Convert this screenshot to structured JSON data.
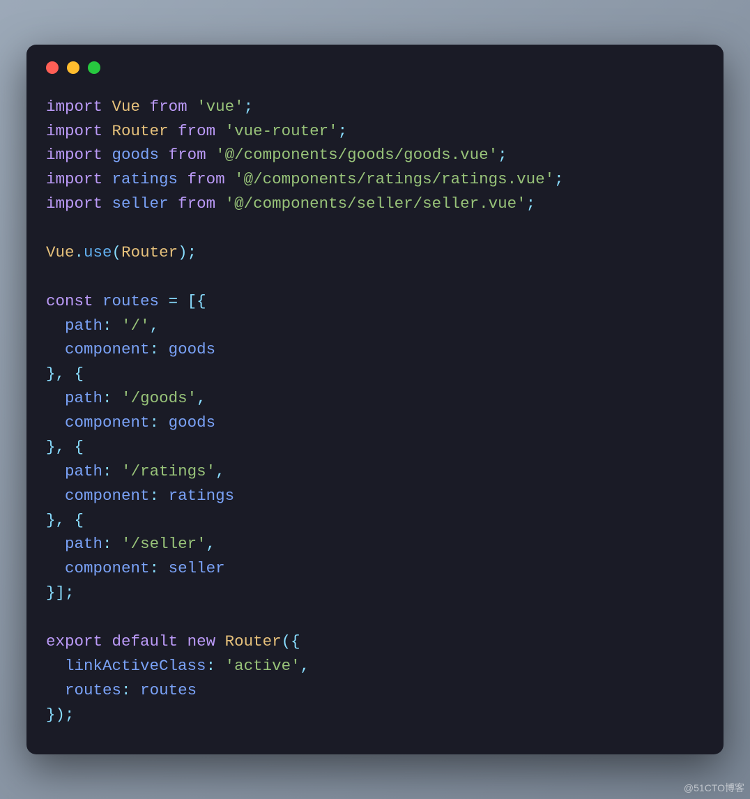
{
  "watermark": "@51CTO博客",
  "titlebar": {
    "dots": [
      "red",
      "yellow",
      "green"
    ]
  },
  "code": {
    "lines": [
      [
        {
          "c": "kw",
          "t": "import"
        },
        {
          "c": "pl",
          "t": " "
        },
        {
          "c": "cls",
          "t": "Vue"
        },
        {
          "c": "pl",
          "t": " "
        },
        {
          "c": "kw",
          "t": "from"
        },
        {
          "c": "pl",
          "t": " "
        },
        {
          "c": "str",
          "t": "'vue'"
        },
        {
          "c": "pun",
          "t": ";"
        }
      ],
      [
        {
          "c": "kw",
          "t": "import"
        },
        {
          "c": "pl",
          "t": " "
        },
        {
          "c": "cls",
          "t": "Router"
        },
        {
          "c": "pl",
          "t": " "
        },
        {
          "c": "kw",
          "t": "from"
        },
        {
          "c": "pl",
          "t": " "
        },
        {
          "c": "str",
          "t": "'vue-router'"
        },
        {
          "c": "pun",
          "t": ";"
        }
      ],
      [
        {
          "c": "kw",
          "t": "import"
        },
        {
          "c": "pl",
          "t": " "
        },
        {
          "c": "id",
          "t": "goods"
        },
        {
          "c": "pl",
          "t": " "
        },
        {
          "c": "kw",
          "t": "from"
        },
        {
          "c": "pl",
          "t": " "
        },
        {
          "c": "str",
          "t": "'@/components/goods/goods.vue'"
        },
        {
          "c": "pun",
          "t": ";"
        }
      ],
      [
        {
          "c": "kw",
          "t": "import"
        },
        {
          "c": "pl",
          "t": " "
        },
        {
          "c": "id",
          "t": "ratings"
        },
        {
          "c": "pl",
          "t": " "
        },
        {
          "c": "kw",
          "t": "from"
        },
        {
          "c": "pl",
          "t": " "
        },
        {
          "c": "str",
          "t": "'@/components/ratings/ratings.vue'"
        },
        {
          "c": "pun",
          "t": ";"
        }
      ],
      [
        {
          "c": "kw",
          "t": "import"
        },
        {
          "c": "pl",
          "t": " "
        },
        {
          "c": "id",
          "t": "seller"
        },
        {
          "c": "pl",
          "t": " "
        },
        {
          "c": "kw",
          "t": "from"
        },
        {
          "c": "pl",
          "t": " "
        },
        {
          "c": "str",
          "t": "'@/components/seller/seller.vue'"
        },
        {
          "c": "pun",
          "t": ";"
        }
      ],
      [],
      [
        {
          "c": "cls",
          "t": "Vue"
        },
        {
          "c": "pun",
          "t": "."
        },
        {
          "c": "fn",
          "t": "use"
        },
        {
          "c": "pun",
          "t": "("
        },
        {
          "c": "cls",
          "t": "Router"
        },
        {
          "c": "pun",
          "t": ");"
        }
      ],
      [],
      [
        {
          "c": "kw",
          "t": "const"
        },
        {
          "c": "pl",
          "t": " "
        },
        {
          "c": "id",
          "t": "routes"
        },
        {
          "c": "pl",
          "t": " "
        },
        {
          "c": "op",
          "t": "="
        },
        {
          "c": "pl",
          "t": " "
        },
        {
          "c": "pun",
          "t": "[{"
        }
      ],
      [
        {
          "c": "pl",
          "t": "  "
        },
        {
          "c": "id",
          "t": "path"
        },
        {
          "c": "pun",
          "t": ":"
        },
        {
          "c": "pl",
          "t": " "
        },
        {
          "c": "str",
          "t": "'/'"
        },
        {
          "c": "pun",
          "t": ","
        }
      ],
      [
        {
          "c": "pl",
          "t": "  "
        },
        {
          "c": "id",
          "t": "component"
        },
        {
          "c": "pun",
          "t": ":"
        },
        {
          "c": "pl",
          "t": " "
        },
        {
          "c": "id",
          "t": "goods"
        }
      ],
      [
        {
          "c": "pun",
          "t": "},"
        },
        {
          "c": "pl",
          "t": " "
        },
        {
          "c": "pun",
          "t": "{"
        }
      ],
      [
        {
          "c": "pl",
          "t": "  "
        },
        {
          "c": "id",
          "t": "path"
        },
        {
          "c": "pun",
          "t": ":"
        },
        {
          "c": "pl",
          "t": " "
        },
        {
          "c": "str",
          "t": "'/goods'"
        },
        {
          "c": "pun",
          "t": ","
        }
      ],
      [
        {
          "c": "pl",
          "t": "  "
        },
        {
          "c": "id",
          "t": "component"
        },
        {
          "c": "pun",
          "t": ":"
        },
        {
          "c": "pl",
          "t": " "
        },
        {
          "c": "id",
          "t": "goods"
        }
      ],
      [
        {
          "c": "pun",
          "t": "},"
        },
        {
          "c": "pl",
          "t": " "
        },
        {
          "c": "pun",
          "t": "{"
        }
      ],
      [
        {
          "c": "pl",
          "t": "  "
        },
        {
          "c": "id",
          "t": "path"
        },
        {
          "c": "pun",
          "t": ":"
        },
        {
          "c": "pl",
          "t": " "
        },
        {
          "c": "str",
          "t": "'/ratings'"
        },
        {
          "c": "pun",
          "t": ","
        }
      ],
      [
        {
          "c": "pl",
          "t": "  "
        },
        {
          "c": "id",
          "t": "component"
        },
        {
          "c": "pun",
          "t": ":"
        },
        {
          "c": "pl",
          "t": " "
        },
        {
          "c": "id",
          "t": "ratings"
        }
      ],
      [
        {
          "c": "pun",
          "t": "},"
        },
        {
          "c": "pl",
          "t": " "
        },
        {
          "c": "pun",
          "t": "{"
        }
      ],
      [
        {
          "c": "pl",
          "t": "  "
        },
        {
          "c": "id",
          "t": "path"
        },
        {
          "c": "pun",
          "t": ":"
        },
        {
          "c": "pl",
          "t": " "
        },
        {
          "c": "str",
          "t": "'/seller'"
        },
        {
          "c": "pun",
          "t": ","
        }
      ],
      [
        {
          "c": "pl",
          "t": "  "
        },
        {
          "c": "id",
          "t": "component"
        },
        {
          "c": "pun",
          "t": ":"
        },
        {
          "c": "pl",
          "t": " "
        },
        {
          "c": "id",
          "t": "seller"
        }
      ],
      [
        {
          "c": "pun",
          "t": "}];"
        }
      ],
      [],
      [
        {
          "c": "kw",
          "t": "export"
        },
        {
          "c": "pl",
          "t": " "
        },
        {
          "c": "kw",
          "t": "default"
        },
        {
          "c": "pl",
          "t": " "
        },
        {
          "c": "kw",
          "t": "new"
        },
        {
          "c": "pl",
          "t": " "
        },
        {
          "c": "cls",
          "t": "Router"
        },
        {
          "c": "pun",
          "t": "({"
        }
      ],
      [
        {
          "c": "pl",
          "t": "  "
        },
        {
          "c": "id",
          "t": "linkActiveClass"
        },
        {
          "c": "pun",
          "t": ":"
        },
        {
          "c": "pl",
          "t": " "
        },
        {
          "c": "str",
          "t": "'active'"
        },
        {
          "c": "pun",
          "t": ","
        }
      ],
      [
        {
          "c": "pl",
          "t": "  "
        },
        {
          "c": "id",
          "t": "routes"
        },
        {
          "c": "pun",
          "t": ":"
        },
        {
          "c": "pl",
          "t": " "
        },
        {
          "c": "id",
          "t": "routes"
        }
      ],
      [
        {
          "c": "pun",
          "t": "});"
        }
      ]
    ]
  }
}
